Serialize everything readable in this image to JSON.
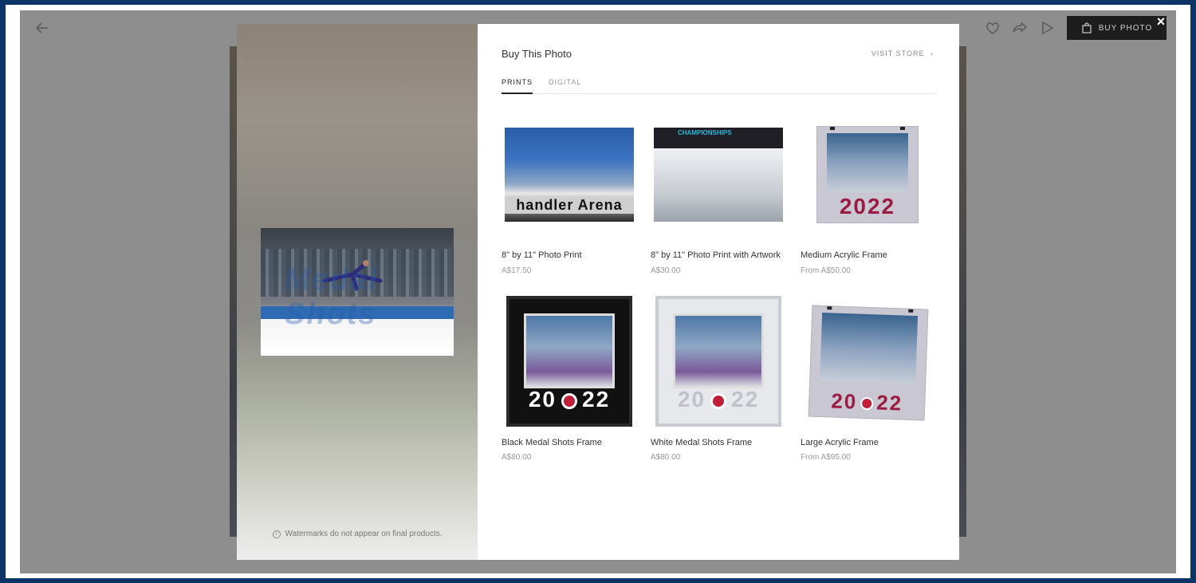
{
  "toolbar": {
    "buy_photo_label": "BUY PHOTO",
    "close_label": "×"
  },
  "modal": {
    "title": "Buy This Photo",
    "visit_store_label": "VISIT STORE",
    "visit_store_chevron": "›",
    "tabs": [
      {
        "label": "PRINTS",
        "active": true
      },
      {
        "label": "DIGITAL",
        "active": false
      }
    ],
    "preview": {
      "watermark_text": "Medal Shots"
    },
    "watermark_note": "Watermarks do not appear on final products.",
    "products": [
      {
        "name": "8\" by 11\" Photo Print",
        "price": "A$17.50",
        "thumb_text": "handler Arena"
      },
      {
        "name": "8\" by 11\" Photo Print with Artwork",
        "price": "A$30.00",
        "thumb_text": "CHAMPIONSHIPS"
      },
      {
        "name": "Medium Acrylic Frame",
        "price": "From A$50.00",
        "thumb_text": "2022"
      },
      {
        "name": "Black Medal Shots Frame",
        "price": "A$80.00",
        "year_left": "20",
        "year_right": "22"
      },
      {
        "name": "White Medal Shots Frame",
        "price": "A$80.00",
        "year_left": "20",
        "year_right": "22"
      },
      {
        "name": "Large Acrylic Frame",
        "price": "From A$95.00",
        "year_left": "20",
        "year_right": "22"
      }
    ]
  },
  "colors": {
    "outer_border": "#0c3466",
    "backdrop": "#8e8e8e",
    "buy_button": "#1d1d1d",
    "frame_year": "#9b1c43"
  },
  "icons": [
    "back-arrow-icon",
    "heart-icon",
    "share-icon",
    "play-icon",
    "shopping-bag-icon",
    "close-icon",
    "info-icon",
    "chevron-right-icon"
  ]
}
